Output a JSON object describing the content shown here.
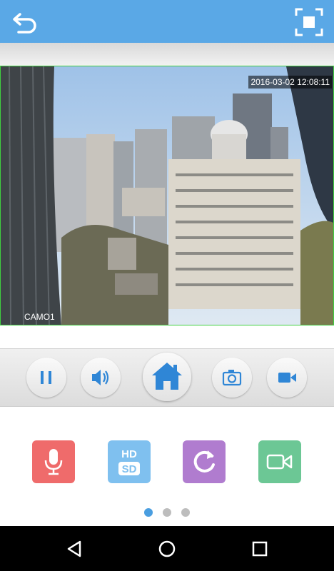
{
  "video": {
    "timestamp": "2016-03-02 12:08:11",
    "camera_name": "CAMO1"
  },
  "toolbar": {
    "back_icon": "back-arrow-icon",
    "fullscreen_icon": "fullscreen-icon"
  },
  "controls": {
    "buttons": [
      "pause-icon",
      "speaker-icon",
      "home-icon",
      "camera-icon",
      "video-record-icon"
    ],
    "accent_color": "#2f86d6"
  },
  "features": [
    {
      "icon": "microphone-icon",
      "color": "#ef6b6b"
    },
    {
      "icon": "hd-sd-icon",
      "color": "#7fc0ef",
      "label_top": "HD",
      "label_bottom": "SD"
    },
    {
      "icon": "refresh-icon",
      "color": "#b07ccf"
    },
    {
      "icon": "video-camera-icon",
      "color": "#6cc795"
    }
  ],
  "pager": {
    "pages": 3,
    "active": 1,
    "active_color": "#4a9ee0",
    "inactive_color": "#bdbdbd"
  },
  "navbar": {
    "buttons": [
      "nav-back-icon",
      "nav-home-icon",
      "nav-recents-icon"
    ]
  }
}
